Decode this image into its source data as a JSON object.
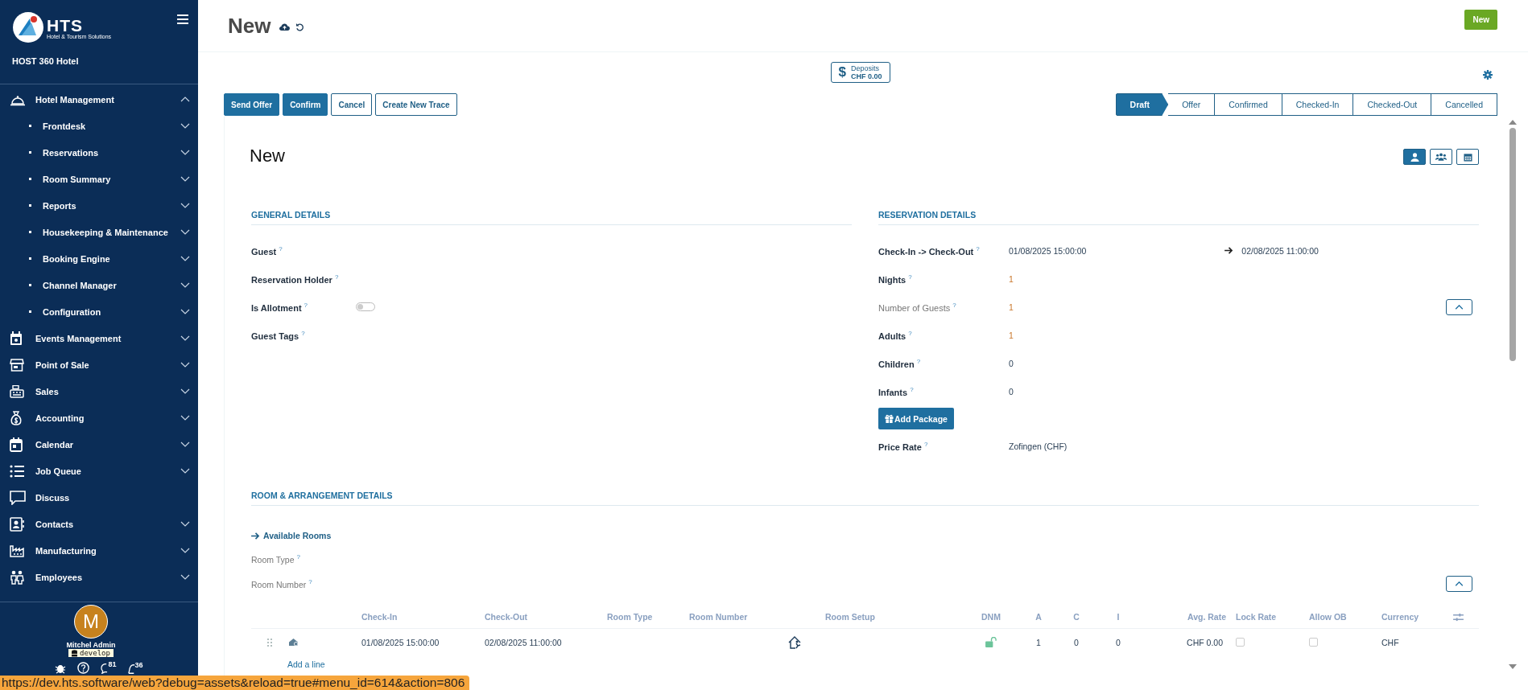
{
  "sidebar": {
    "logo_text": "HTS",
    "logo_tagline": "Hotel & Tourism Solutions",
    "company": "HOST 360 Hotel",
    "menu": [
      {
        "label": "Hotel Management",
        "expanded": true,
        "children": [
          {
            "label": "Frontdesk",
            "expanded": false
          },
          {
            "label": "Reservations",
            "expanded": false
          },
          {
            "label": "Room Summary",
            "expanded": false
          },
          {
            "label": "Reports",
            "expanded": false
          },
          {
            "label": "Housekeeping & Maintenance",
            "expanded": false
          },
          {
            "label": "Booking Engine",
            "expanded": false
          },
          {
            "label": "Channel Manager",
            "expanded": false
          },
          {
            "label": "Configuration",
            "expanded": false
          }
        ]
      },
      {
        "label": "Events Management",
        "expanded": false
      },
      {
        "label": "Point of Sale",
        "expanded": false
      },
      {
        "label": "Sales",
        "expanded": false
      },
      {
        "label": "Accounting",
        "expanded": false
      },
      {
        "label": "Calendar",
        "expanded": false
      },
      {
        "label": "Job Queue",
        "expanded": false
      },
      {
        "label": "Discuss"
      },
      {
        "label": "Contacts",
        "expanded": false
      },
      {
        "label": "Manufacturing",
        "expanded": false
      },
      {
        "label": "Employees",
        "expanded": false
      }
    ],
    "user": {
      "initial": "M",
      "name": "Mitchel Admin",
      "database": "develop"
    },
    "counters": [
      "81",
      "36"
    ]
  },
  "header": {
    "title": "New",
    "new_button": "New"
  },
  "deposits": {
    "symbol": "$",
    "label": "Deposits",
    "amount": "CHF 0.00"
  },
  "actions": [
    {
      "label": "Send Offer",
      "primary": true
    },
    {
      "label": "Confirm",
      "primary": true
    },
    {
      "label": "Cancel",
      "primary": false
    },
    {
      "label": "Create New Trace",
      "primary": false
    }
  ],
  "stages": [
    {
      "label": "Draft",
      "selected": true
    },
    {
      "label": "Offer",
      "selected": false
    },
    {
      "label": "Confirmed",
      "selected": false
    },
    {
      "label": "Checked-In",
      "selected": false
    },
    {
      "label": "Checked-Out",
      "selected": false
    },
    {
      "label": "Cancelled",
      "selected": false
    }
  ],
  "form": {
    "title": "New",
    "views": [
      {
        "selected": true
      },
      {
        "selected": false
      },
      {
        "selected": false
      }
    ],
    "general": {
      "heading": "GENERAL DETAILS",
      "fields": [
        {
          "label": "Guest $^{?}$",
          "kind": "empty"
        },
        {
          "label": "Reservation Holder $^{?}$",
          "kind": "empty"
        },
        {
          "label": "Is Allotment $^{?}$",
          "kind": "toggle",
          "on": false
        },
        {
          "label": "Guest Tags $^{?}$",
          "kind": "empty"
        }
      ]
    },
    "reservation": {
      "heading": "RESERVATION DETAILS",
      "fields": [
        {
          "label": "Check-In -> Check-Out $^{?}$",
          "kind": "range",
          "value": "01/08/2025 15:00:00",
          "end": "02/08/2025 11:00:00",
          "muted": false,
          "highlighted": false
        },
        {
          "label": "Nights $^{?}$",
          "kind": "value",
          "value": "1",
          "muted": false,
          "highlighted": true
        },
        {
          "label": "Number of Guests $^{?}$",
          "kind": "collapsible",
          "value": "1",
          "muted": true,
          "highlighted": true
        },
        {
          "label": "Adults $^{?}$",
          "kind": "value",
          "value": "1",
          "muted": false,
          "highlighted": true
        },
        {
          "label": "Children $^{?}$",
          "kind": "value",
          "value": "0",
          "muted": false,
          "highlighted": false
        },
        {
          "label": "Infants $^{?}$",
          "kind": "value",
          "value": "0",
          "muted": false,
          "highlighted": false
        },
        {
          "label": "Add Package",
          "kind": "button"
        },
        {
          "label": "Price Rate $^{?}$",
          "kind": "value",
          "value": "Zofingen (CHF)",
          "muted": false,
          "highlighted": false
        }
      ]
    },
    "rooms": {
      "heading": "ROOM & ARRANGEMENT DETAILS",
      "link": "Available Rooms",
      "fields": [
        {
          "label": "Room Type $^{?}$"
        },
        {
          "label": "Room Number $^{?}$"
        }
      ],
      "columns": [
        "Check-In",
        "Check-Out",
        "Room Type",
        "Room Number",
        "Room Setup",
        "DNM",
        "A",
        "C",
        "I",
        "Avg. Rate",
        "Lock Rate",
        "Allow OB",
        "Currency"
      ],
      "rows": [
        {
          "check_in": "01/08/2025 15:00:00",
          "check_out": "02/08/2025 11:00:00",
          "dnm_locked": false,
          "adults": "1",
          "children": "0",
          "infants": "0",
          "avg_rate": "CHF 0.00",
          "lock_rate": false,
          "allow_ob": false,
          "currency": "CHF"
        }
      ],
      "add_line": "Add a line"
    }
  },
  "status_url": "https://dev.hts.software/web?debug=assets&reload=true#menu_id=614&action=806"
}
